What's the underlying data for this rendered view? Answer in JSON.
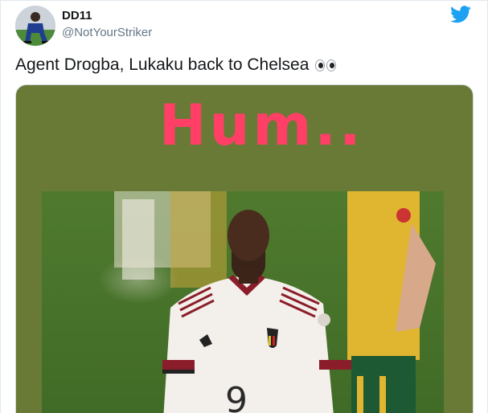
{
  "user": {
    "display_name": "DD11",
    "handle": "@NotYourStriker",
    "avatar": "user-avatar"
  },
  "tweet": {
    "text": "Agent Drogba, Lukaku back to Chelsea",
    "emoji": "eyes-emoji"
  },
  "media": {
    "overlay_text": "Hum..",
    "image": "footballer-photo",
    "jersey_number": "9",
    "background_color": "#697a36",
    "overlay_color": "#ff3f66"
  },
  "icons": {
    "brand": "twitter-bird-icon"
  },
  "colors": {
    "twitter_blue": "#1da1f2",
    "handle_gray": "#657786"
  }
}
